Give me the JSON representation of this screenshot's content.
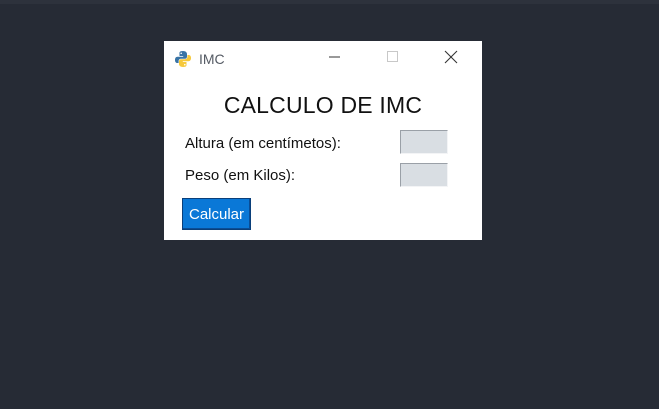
{
  "window": {
    "title": "IMC",
    "icon": "python-icon",
    "controls": [
      "minimize",
      "maximize",
      "close"
    ]
  },
  "form": {
    "heading": "CALCULO DE IMC",
    "altura_label": "Altura (em centímetos):",
    "altura_value": "",
    "peso_label": "Peso (em Kilos):",
    "peso_value": "",
    "calc_button": "Calcular"
  },
  "colors": {
    "desktop": "#262b35",
    "window": "#ffffff",
    "button": "#0a78d7",
    "entry": "#d9dee3"
  }
}
